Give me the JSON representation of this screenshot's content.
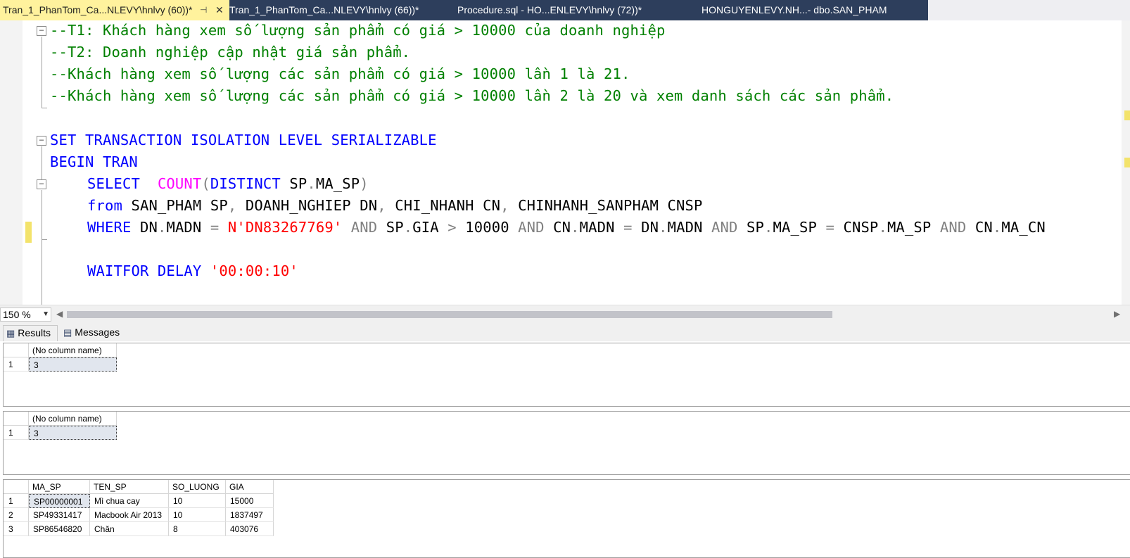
{
  "tabs": [
    {
      "label": "Tran_1_PhanTom_Ca...NLEVY\\hnlvy (60))*",
      "active": true
    },
    {
      "label": "Tran_1_PhanTom_Ca...NLEVY\\hnlvy (66))*",
      "active": false
    },
    {
      "label": "Procedure.sql - HO...ENLEVY\\hnlvy (72))*",
      "active": false
    },
    {
      "label": "HONGUYENLEVY.NH...- dbo.SAN_PHAM",
      "active": false
    }
  ],
  "icons": {
    "pin": "pin-icon",
    "close": "close-icon",
    "grid": "grid-icon",
    "messages": "messages-icon"
  },
  "code": {
    "comment1": "--T1: Khách hàng xem số lượng sản phẩm có giá > 10000 của doanh nghiệp",
    "comment2": "--T2: Doanh nghiệp cập nhật giá sản phẩm.",
    "comment3": "--Khách hàng xem số lượng các sản phẩm có giá > 10000 lần 1 là 21.",
    "comment4": "--Khách hàng xem số lượng các sản phẩm có giá > 10000 lần 2 là 20 và xem danh sách các sản phẩm.",
    "set_tran": "SET TRANSACTION ISOLATION LEVEL SERIALIZABLE",
    "begin_tran": "BEGIN TRAN",
    "select_kw": "SELECT",
    "count_fn": "COUNT",
    "select_rest_open": "(",
    "distinct_kw": "DISTINCT",
    "select_field": " SP",
    "select_dot": ".",
    "select_col": "MA_SP",
    "select_close": ")",
    "from_kw": "from",
    "from_t1": " SAN_PHAM SP",
    "from_c1": ",",
    "from_t2": " DOANH_NGHIEP DN",
    "from_c2": ",",
    "from_t3": " CHI_NHANH CN",
    "from_c3": ",",
    "from_t4": " CHINHANH_SANPHAM CNSP",
    "where_kw": "WHERE",
    "w1a": " DN",
    "w1dot": ".",
    "w1b": "MADN ",
    "w1eq": "=",
    "w1str": " N'DN83267769'",
    "and1": " AND",
    "w2a": " SP",
    "w2dot": ".",
    "w2b": "GIA ",
    "w2gt": ">",
    "w2num": " 10000",
    "and2": " AND",
    "w3a": " CN",
    "w3dot": ".",
    "w3b": "MADN ",
    "w3eq": "=",
    "w3c": " DN",
    "w3dot2": ".",
    "w3d": "MADN",
    "and3": " AND",
    "w4a": " SP",
    "w4dot": ".",
    "w4b": "MA_SP ",
    "w4eq": "=",
    "w4c": " CNSP",
    "w4dot2": ".",
    "w4d": "MA_SP",
    "and4": " AND",
    "w5a": " CN",
    "w5dot": ".",
    "w5b": "MA_CN",
    "waitfor_kw": "WAITFOR DELAY",
    "waitfor_str": " '00:00:10'"
  },
  "editor_bar": {
    "zoom": "150 %"
  },
  "result_tabs": {
    "results": "Results",
    "messages": "Messages"
  },
  "grid1": {
    "header": "(No column name)",
    "rows": [
      {
        "num": "1",
        "value": "3"
      }
    ]
  },
  "grid2": {
    "header": "(No column name)",
    "rows": [
      {
        "num": "1",
        "value": "3"
      }
    ]
  },
  "grid3": {
    "headers": [
      "MA_SP",
      "TEN_SP",
      "SO_LUONG",
      "GIA"
    ],
    "rows": [
      {
        "num": "1",
        "cells": [
          "SP00000001",
          "Mì chua cay",
          "10",
          "15000"
        ]
      },
      {
        "num": "2",
        "cells": [
          "SP49331417",
          "Macbook Air 2013",
          "10",
          "1837497"
        ]
      },
      {
        "num": "3",
        "cells": [
          "SP86546820",
          "Chăn",
          "8",
          "403076"
        ]
      }
    ]
  }
}
